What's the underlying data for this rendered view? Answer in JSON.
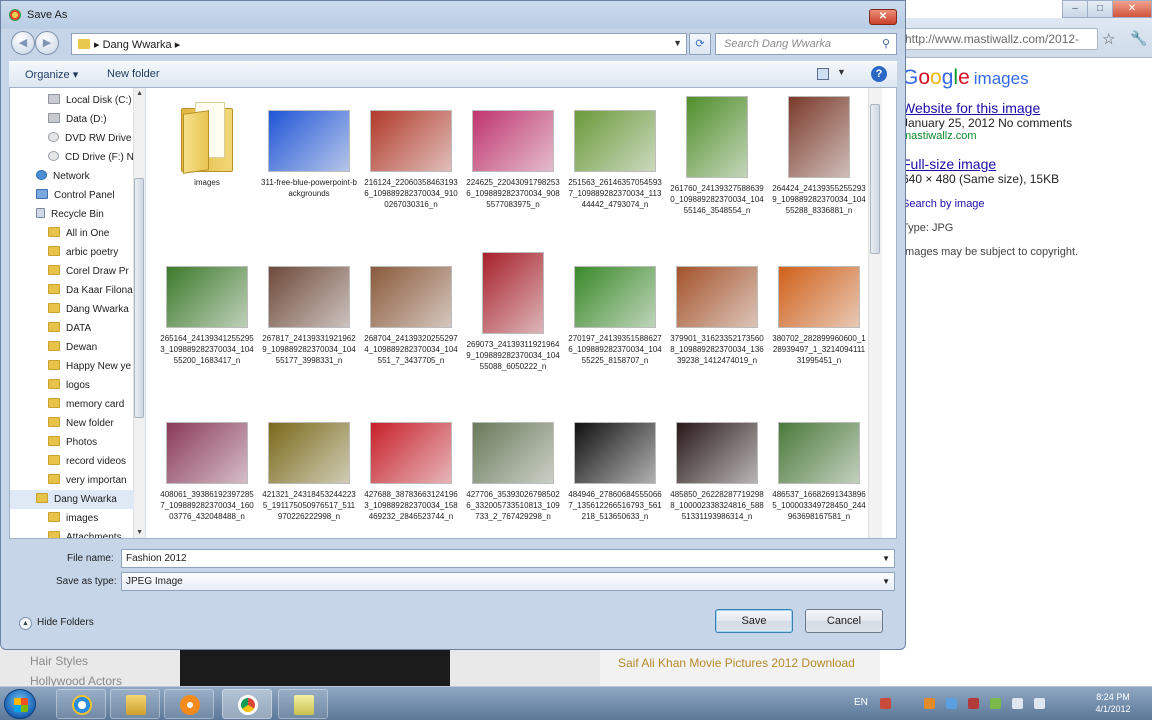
{
  "browser": {
    "url": "http://www.mastiwallz.com/2012-",
    "google_images_label": "images",
    "website_link": "Website for this image",
    "date_line": "January 25, 2012 No comments",
    "site": "mastiwallz.com",
    "fullsize_link": "Full-size image",
    "size_line": "640 × 480 (Same size), 15KB",
    "search_by_image": "Search by image",
    "type_line": "Type: JPG",
    "copyright": "Images may be subject to copyright."
  },
  "background": {
    "left_item_1": "Hair Styles",
    "left_item_2": "Hollywood Actors",
    "right_link": "Saif Ali Khan Movie Pictures 2012 Download"
  },
  "dialog": {
    "title": "Save As",
    "address_crumb": "▸ Dang Wwarka ▸",
    "search_placeholder": "Search Dang Wwarka",
    "toolbar": {
      "organize": "Organize ▾",
      "new_folder": "New folder"
    },
    "nav_items": [
      {
        "label": "Local Disk (C:)",
        "icon": "drive"
      },
      {
        "label": "Data (D:)",
        "icon": "drive"
      },
      {
        "label": "DVD RW Drive",
        "icon": "disc"
      },
      {
        "label": "CD Drive (F:) N",
        "icon": "disc"
      },
      {
        "label": "Network",
        "icon": "net"
      },
      {
        "label": "Control Panel",
        "icon": "cp"
      },
      {
        "label": "Recycle Bin",
        "icon": "bin"
      },
      {
        "label": "All in One",
        "icon": "folder"
      },
      {
        "label": "arbic poetry",
        "icon": "folder"
      },
      {
        "label": "Corel Draw Pr",
        "icon": "folder"
      },
      {
        "label": "Da Kaar Filona",
        "icon": "folder"
      },
      {
        "label": "Dang Wwarka",
        "icon": "folder"
      },
      {
        "label": "DATA",
        "icon": "folder"
      },
      {
        "label": "Dewan",
        "icon": "folder"
      },
      {
        "label": "Happy New ye",
        "icon": "folder"
      },
      {
        "label": "logos",
        "icon": "folder"
      },
      {
        "label": "memory card",
        "icon": "folder"
      },
      {
        "label": "New folder",
        "icon": "folder"
      },
      {
        "label": "Photos",
        "icon": "folder"
      },
      {
        "label": "record videos",
        "icon": "folder"
      },
      {
        "label": "very importan",
        "icon": "folder"
      },
      {
        "label": "Dang Wwarka",
        "icon": "folder",
        "selected": true
      },
      {
        "label": "images",
        "icon": "folder"
      },
      {
        "label": "Attachments_",
        "icon": "folder"
      }
    ],
    "files": [
      {
        "name": "images",
        "kind": "folder"
      },
      {
        "name": "311-free-blue-powerpoint-backgrounds",
        "color": "#1f56d6"
      },
      {
        "name": "216124_220603584631936_109889282370034_9100267030316_n",
        "color": "#b23a2a"
      },
      {
        "name": "224625_220430917982536_109889282370034_9085577083975_n",
        "color": "#c0356e"
      },
      {
        "name": "251563_261463570545937_109889282370034_11344442_4793074_n",
        "color": "#6a9a3a"
      },
      {
        "name": "261760_241393275886390_109889282370034_10455146_3548554_n",
        "color": "#4f8f2a"
      },
      {
        "name": "264424_241393552552939_109889282370034_10455288_8336881_n",
        "color": "#7a3a2a"
      },
      {
        "name": "265164_241393412552953_109889282370034_10455200_1683417_n",
        "color": "#3c7a2a"
      },
      {
        "name": "267817_241393319219629_109889282370034_10455177_3998331_n",
        "color": "#6e4a3a"
      },
      {
        "name": "268704_241393202552974_109889282370034_104551_7_3437705_n",
        "color": "#8a5a3a"
      },
      {
        "name": "269073_241393119219649_109889282370034_10455088_6050222_n",
        "color": "#a8202a"
      },
      {
        "name": "270197_241393515886276_109889282370034_10455225_8158707_n",
        "color": "#3a8a2a"
      },
      {
        "name": "379901_316233521735608_109889282370034_13639238_1412474019_n",
        "color": "#a4532a"
      },
      {
        "name": "380702_282899960600_128939497_1_321409411131995451_n",
        "color": "#d0601a"
      },
      {
        "name": "408061_393861923972857_109889282370034_16003776_432048488_n",
        "color": "#8a3a5a"
      },
      {
        "name": "421321_243184532442235_191175050976517_511970226222998_n",
        "color": "#7a6a1a"
      },
      {
        "name": "427688_387836631241963_109889282370034_158469232_2846523744_n",
        "color": "#c8202a"
      },
      {
        "name": "427706_353930267985026_332005733510813_109733_2_767429298_n",
        "color": "#6a7a5a"
      },
      {
        "name": "484946_278606845550667_135612266516793_561218_513650633_n",
        "color": "#111111"
      },
      {
        "name": "485850_262282877192988_100002338324816_58851331193986314_n",
        "color": "#2a1a1a"
      },
      {
        "name": "486537_166826913438965_100003349728450_244963698167581_n",
        "color": "#4a7a3a"
      },
      {
        "name": "",
        "color": "#d86a6a"
      },
      {
        "name": "",
        "color": "#3a3a3a"
      },
      {
        "name": "",
        "color": "#5a3a2a"
      },
      {
        "name": "",
        "color": "#2a2a2a"
      },
      {
        "name": "",
        "color": "#c8c0a0"
      }
    ],
    "file_name_label": "File name:",
    "file_name_value": "Fashion 2012",
    "save_type_label": "Save as type:",
    "save_type_value": "JPEG Image",
    "hide_folders": "Hide Folders",
    "save_button": "Save",
    "cancel_button": "Cancel"
  },
  "taskbar": {
    "language": "EN",
    "time": "8:24 PM",
    "date": "4/1/2012"
  }
}
